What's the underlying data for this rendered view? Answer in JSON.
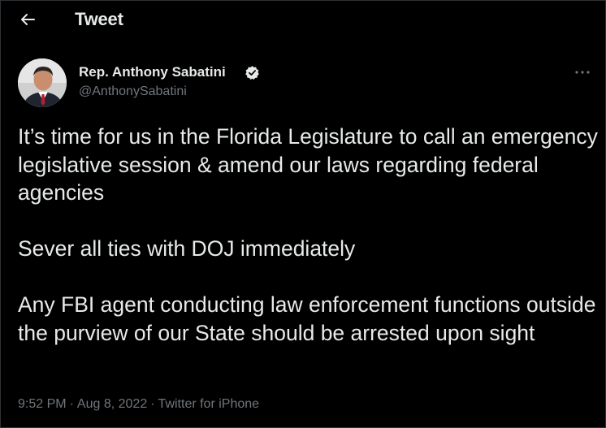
{
  "header": {
    "title": "Tweet",
    "back_icon": "back-arrow-icon"
  },
  "author": {
    "display_name": "Rep. Anthony Sabatini",
    "handle": "@AnthonySabatini",
    "verified_icon": "verified-badge-icon",
    "avatar_icon": "profile-avatar"
  },
  "more_icon": "more-options-icon",
  "tweet": {
    "paragraphs": [
      "It’s time for us in the Florida Legislature to call an emergency legislative session & amend our laws regarding federal agencies",
      "Sever all ties with DOJ immediately",
      "Any FBI agent conducting law enforcement functions outside the purview of our State should be arrested upon sight"
    ]
  },
  "meta": {
    "time": "9:52 PM",
    "separator": "·",
    "date": "Aug 8, 2022",
    "source": "Twitter for iPhone"
  },
  "colors": {
    "background": "#000000",
    "text": "#e7e9ea",
    "secondary": "#71767b",
    "border": "#2f3336"
  }
}
